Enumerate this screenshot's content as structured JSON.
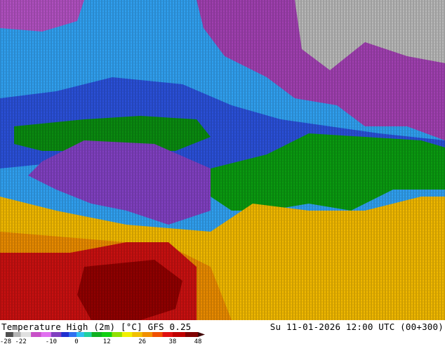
{
  "map": {
    "description_colors": {
      "cold_grey": "#b4b4b4",
      "purple": "#a040b0",
      "magenta": "#d060d0",
      "blue": "#3060e0",
      "light_blue": "#40a0f0",
      "cyan": "#30d0e0",
      "green": "#10a010",
      "dark_green": "#087010",
      "yellow": "#f0d000",
      "orange": "#f0a000",
      "red": "#c81010",
      "dark_red": "#900000"
    }
  },
  "footer": {
    "title": "Temperature High (2m) [°C] GFS 0.25",
    "datetime": "Su 11-01-2026 12:00 UTC (00+300)"
  },
  "legend": {
    "ticks": [
      "-28",
      "-22",
      "-10",
      "0",
      "12",
      "26",
      "38",
      "48"
    ],
    "stops": [
      {
        "value": -28,
        "color": "#505050"
      },
      {
        "value": -25,
        "color": "#b4b4b4"
      },
      {
        "value": -22,
        "color": "#e0e0e0"
      },
      {
        "value": -18,
        "color": "#c850c8"
      },
      {
        "value": -14,
        "color": "#e070f0"
      },
      {
        "value": -10,
        "color": "#8040c0"
      },
      {
        "value": -6,
        "color": "#2030d0"
      },
      {
        "value": -3,
        "color": "#3070f0"
      },
      {
        "value": 0,
        "color": "#30c0f0"
      },
      {
        "value": 3,
        "color": "#20d0a0"
      },
      {
        "value": 6,
        "color": "#10b020"
      },
      {
        "value": 10,
        "color": "#10d010"
      },
      {
        "value": 14,
        "color": "#90e000"
      },
      {
        "value": 18,
        "color": "#f0f000"
      },
      {
        "value": 22,
        "color": "#f0c000"
      },
      {
        "value": 26,
        "color": "#f09000"
      },
      {
        "value": 30,
        "color": "#f05000"
      },
      {
        "value": 34,
        "color": "#e01010"
      },
      {
        "value": 38,
        "color": "#c00000"
      },
      {
        "value": 43,
        "color": "#800000"
      },
      {
        "value": 48,
        "color": "#400000"
      }
    ]
  }
}
